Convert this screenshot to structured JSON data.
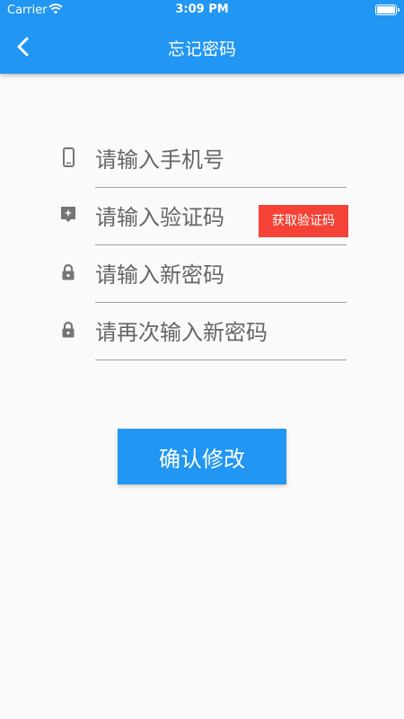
{
  "status_bar": {
    "carrier": "Carrier",
    "time": "3:09 PM"
  },
  "app_bar": {
    "title": "忘记密码",
    "back_icon": "chevron-left-icon"
  },
  "form": {
    "phone": {
      "placeholder": "请输入手机号",
      "icon": "phone-icon"
    },
    "code": {
      "placeholder": "请输入验证码",
      "icon": "verify-code-icon",
      "button_label": "获取验证码"
    },
    "new_password": {
      "placeholder": "请输入新密码",
      "icon": "lock-icon"
    },
    "confirm_password": {
      "placeholder": "请再次输入新密码",
      "icon": "lock-icon"
    }
  },
  "submit_label": "确认修改",
  "colors": {
    "primary": "#2196f3",
    "code_button": "#f44336",
    "background": "#fafafa"
  }
}
